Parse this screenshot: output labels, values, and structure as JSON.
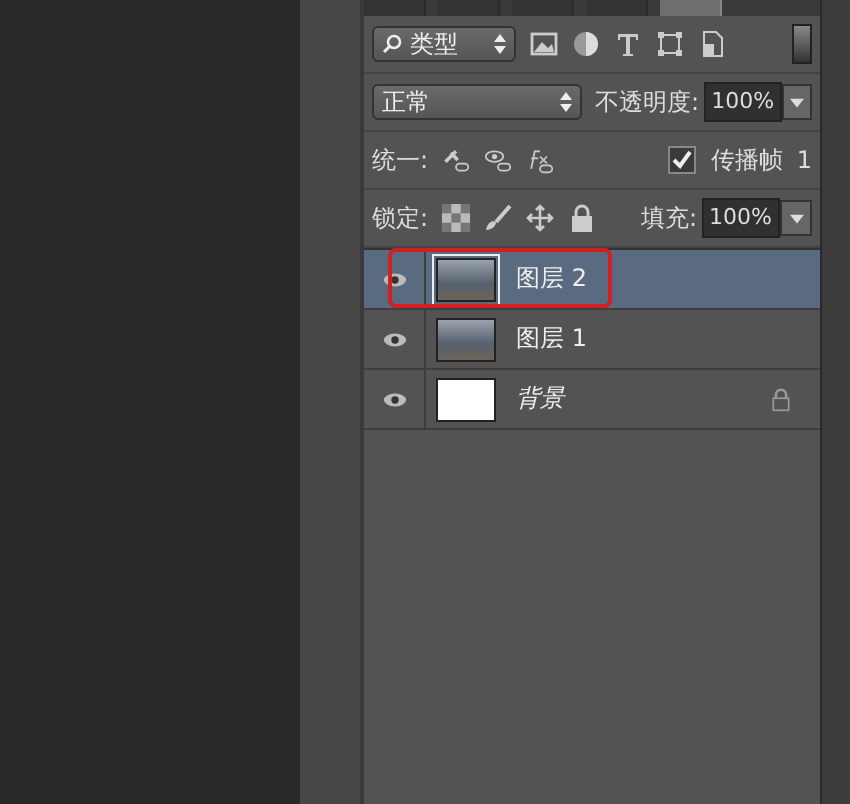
{
  "tabs": [
    {
      "selected": false
    },
    {
      "selected": false
    },
    {
      "selected": false
    },
    {
      "selected": false
    },
    {
      "selected": true
    }
  ],
  "filter": {
    "value": "类型"
  },
  "blend": {
    "value": "正常",
    "opacity_label": "不透明度:",
    "opacity": "100%"
  },
  "unify": {
    "label": "统一:",
    "propagate_label": "传播帧",
    "propagate_checked": true,
    "frame": "1"
  },
  "lock": {
    "label": "锁定:",
    "fill_label": "填充:",
    "fill": "100%"
  },
  "layers": [
    {
      "name": "图层 2",
      "kind": "photo",
      "selected": true,
      "visible": true,
      "locked": false,
      "highlighted": true
    },
    {
      "name": "图层 1",
      "kind": "photo",
      "selected": false,
      "visible": true,
      "locked": false,
      "highlighted": false
    },
    {
      "name": "背景",
      "kind": "background",
      "selected": false,
      "visible": true,
      "locked": true,
      "highlighted": false
    }
  ]
}
